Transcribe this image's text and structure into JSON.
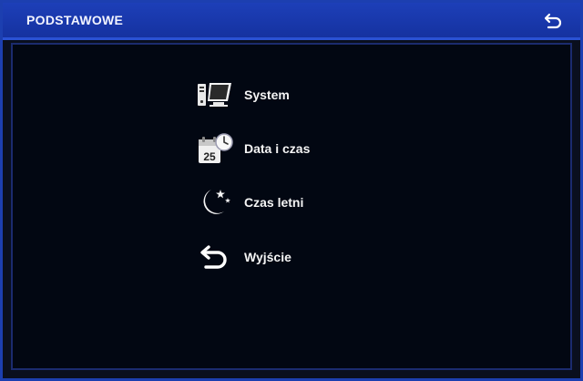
{
  "window": {
    "title": "PODSTAWOWE",
    "back_icon": "back-arrow-icon"
  },
  "menu": {
    "items": [
      {
        "label": "System",
        "icon": "computer-icon"
      },
      {
        "label": "Data i czas",
        "icon": "calendar-clock-icon"
      },
      {
        "label": "Czas letni",
        "icon": "moon-stars-icon"
      },
      {
        "label": "Wyjście",
        "icon": "return-arrow-icon"
      }
    ]
  },
  "colors": {
    "titlebar": "#1d3fb8",
    "border": "#1c3fb0",
    "background": "#020712",
    "text": "#f4f4f4"
  }
}
